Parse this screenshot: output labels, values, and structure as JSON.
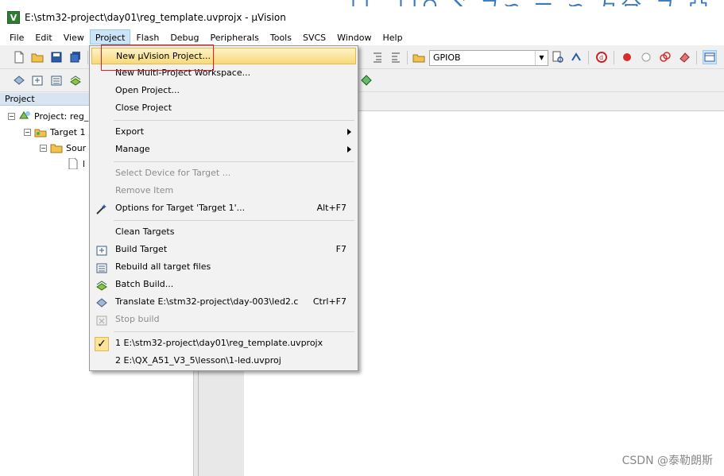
{
  "window": {
    "title": "E:\\stm32-project\\day01\\reg_template.uvprojx - µVision",
    "app_icon_letter": "V"
  },
  "menubar": [
    "File",
    "Edit",
    "View",
    "Project",
    "Flash",
    "Debug",
    "Peripherals",
    "Tools",
    "SVCS",
    "Window",
    "Help"
  ],
  "toolbar": {
    "combo_value": "GPIOB"
  },
  "project_panel": {
    "header": "Project",
    "tree": [
      {
        "label": "Project: reg_",
        "level": 0,
        "expander": "−"
      },
      {
        "label": "Target 1",
        "level": 1,
        "expander": "−"
      },
      {
        "label": "Sour",
        "level": 2,
        "expander": "−"
      },
      {
        "label": "l",
        "level": 3,
        "expander": ""
      }
    ]
  },
  "project_menu": {
    "new_project": {
      "label": "New µVision Project..."
    },
    "new_multi": {
      "label": "New Multi-Project Workspace..."
    },
    "open_project": {
      "label": "Open Project..."
    },
    "close_project": {
      "label": "Close Project"
    },
    "export": {
      "label": "Export"
    },
    "manage": {
      "label": "Manage"
    },
    "select_device": {
      "label": "Select Device for Target ..."
    },
    "remove_item": {
      "label": "Remove Item"
    },
    "options_target": {
      "label": "Options for Target 'Target 1'...",
      "shortcut": "Alt+F7"
    },
    "clean_targets": {
      "label": "Clean Targets"
    },
    "build_target": {
      "label": "Build Target",
      "shortcut": "F7"
    },
    "rebuild_all": {
      "label": "Rebuild all target files"
    },
    "batch_build": {
      "label": "Batch Build..."
    },
    "translate": {
      "label": "Translate E:\\stm32-project\\day-003\\led2.c",
      "shortcut": "Ctrl+F7"
    },
    "stop_build": {
      "label": "Stop build"
    },
    "recent_1": {
      "label": "1 E:\\stm32-project\\day01\\reg_template.uvprojx"
    },
    "recent_2": {
      "label": "2 E:\\QX_A51_V3_5\\lesson\\1-led.uvproj"
    }
  },
  "watermark": "CSDN @泰勒朗斯"
}
